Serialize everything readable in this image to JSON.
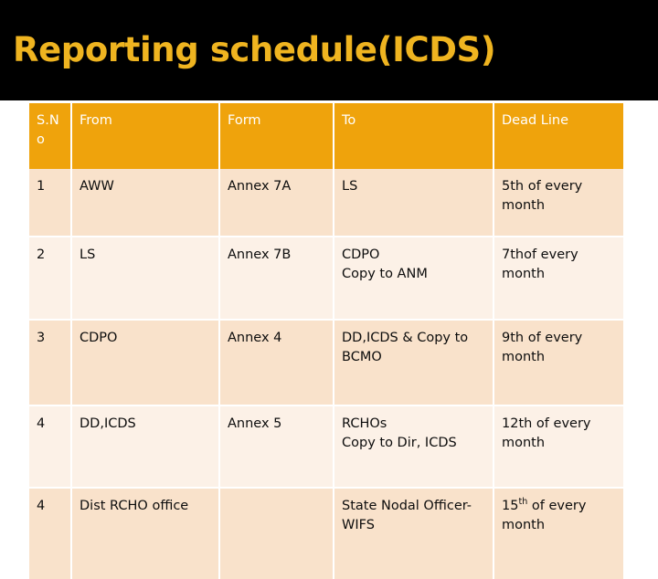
{
  "slide": {
    "title": "Reporting schedule(ICDS)",
    "colors": {
      "title_band_background": "#000000",
      "title_text": "#efb420",
      "table_header_background": "#efa30c",
      "table_header_text": "#ffffff",
      "row_dark_background": "#f9e2cb",
      "row_light_background": "#fcf1e7",
      "cell_text": "#0d0d0d",
      "grid_line": "#ffffff"
    }
  },
  "table": {
    "headers": [
      "S.N o",
      "From",
      "Form",
      "To",
      "Dead Line"
    ],
    "rows": [
      {
        "sno": "1",
        "from": "AWW",
        "form": "Annex 7A",
        "to": "LS",
        "deadline_number": "5th",
        "deadline_rest": " of every month",
        "deadline_full": "5th of every month"
      },
      {
        "sno": "2",
        "from": "LS",
        "form": "Annex 7B",
        "to": "CDPO\nCopy to ANM",
        "deadline_number": "7th",
        "deadline_rest": "of every month",
        "deadline_full": "7thof every month"
      },
      {
        "sno": "3",
        "from": "CDPO",
        "form": "Annex 4",
        "to": "DD,ICDS & Copy to BCMO",
        "deadline_number": "9th",
        "deadline_rest": " of every month",
        "deadline_full": "9th of every month"
      },
      {
        "sno": "4",
        "from": "DD,ICDS",
        "form": "Annex 5",
        "to": "RCHOs\nCopy to Dir, ICDS",
        "deadline_number": "12th",
        "deadline_rest": " of every month",
        "deadline_full": "12th of every month"
      },
      {
        "sno": "4",
        "from": "Dist RCHO office",
        "form": "",
        "to": "State Nodal Officer-WIFS",
        "deadline_number": "15",
        "deadline_superscript": "th",
        "deadline_rest": " of every month",
        "deadline_full": "15th of every month"
      }
    ]
  }
}
